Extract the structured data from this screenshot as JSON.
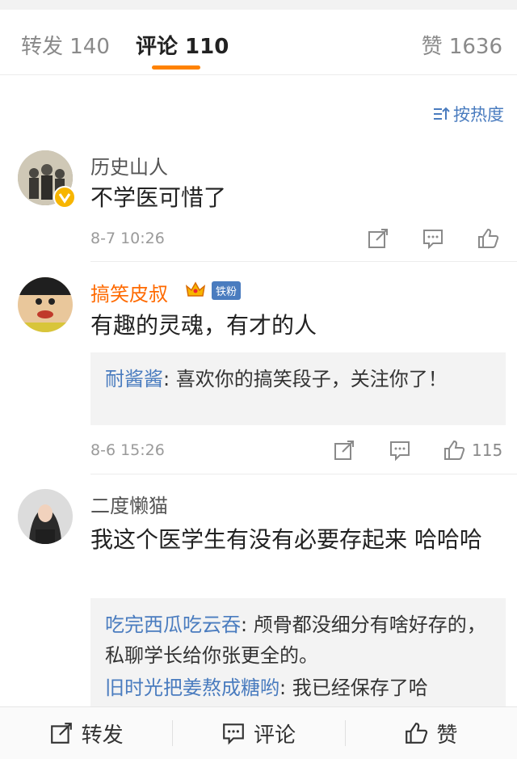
{
  "tabs": {
    "repost": "转发 140",
    "comments": "评论 110",
    "likes": "赞 1636"
  },
  "sort_label": "按热度",
  "comments": [
    {
      "name": "历史山人",
      "text": "不学医可惜了",
      "time": "8-7 10:26",
      "like_count": ""
    },
    {
      "name": "搞笑皮叔",
      "badge": "铁粉",
      "text": "有趣的灵魂，有才的人",
      "reply_user": "耐酱酱",
      "reply_text": ": 喜欢你的搞笑段子，关注你了！",
      "time": "8-6 15:26",
      "like_count": "115"
    },
    {
      "name": "二度懒猫",
      "text": "我这个医学生有没有必要存起来 哈哈哈",
      "replies": [
        {
          "user": "吃完西瓜吃云吞",
          "text": ": 颅骨都没细分有啥好存的，私聊学长给你张更全的。"
        },
        {
          "user": "旧时光把姜熬成糖哟",
          "text": ": 我已经保存了哈"
        }
      ]
    }
  ],
  "bottom_bar": {
    "repost": "转发",
    "comment": "评论",
    "like": "赞"
  },
  "colors": {
    "accent": "#ff8200",
    "link": "#4a7cbf",
    "orange_name": "#ff6a00"
  }
}
